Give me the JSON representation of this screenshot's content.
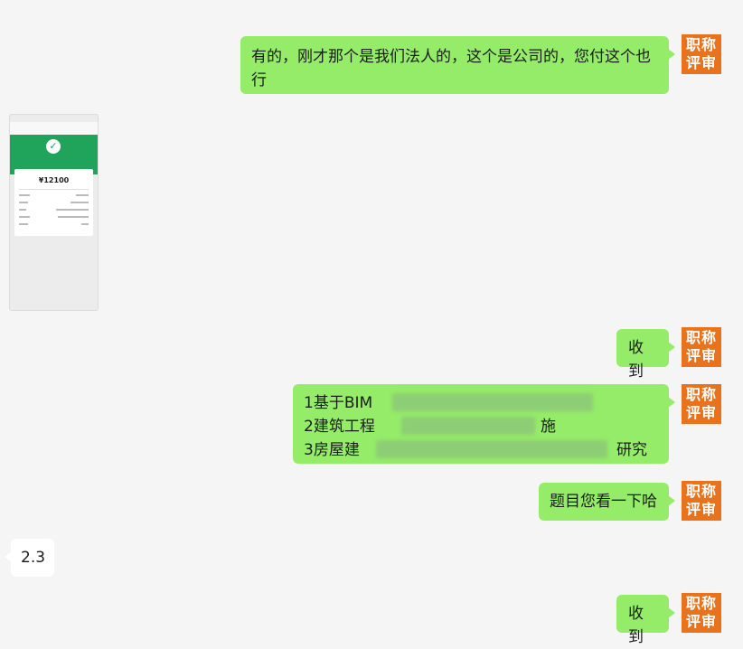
{
  "messages": {
    "m1": {
      "text": "有的，刚才那个是我们法人的，这个是公司的，您付这个也行"
    },
    "m2": {
      "text": "收到"
    },
    "m3": {
      "lines": [
        "1基于BIM",
        "2建筑工程",
        "3房屋建",
        "研究"
      ],
      "tail1": "",
      "tail2": "施"
    },
    "m4": {
      "text": "题目您看一下哈"
    },
    "m5": {
      "text": "2.3"
    },
    "m6": {
      "text": "收到"
    }
  },
  "avatar": {
    "line1": "职称",
    "line2": "评审"
  },
  "thumbnail": {
    "amount": "¥12100"
  },
  "colors": {
    "outgoing_bubble": "#95ec69",
    "incoming_bubble": "#ffffff",
    "avatar": "#e8731c",
    "background": "#f5f5f5"
  }
}
